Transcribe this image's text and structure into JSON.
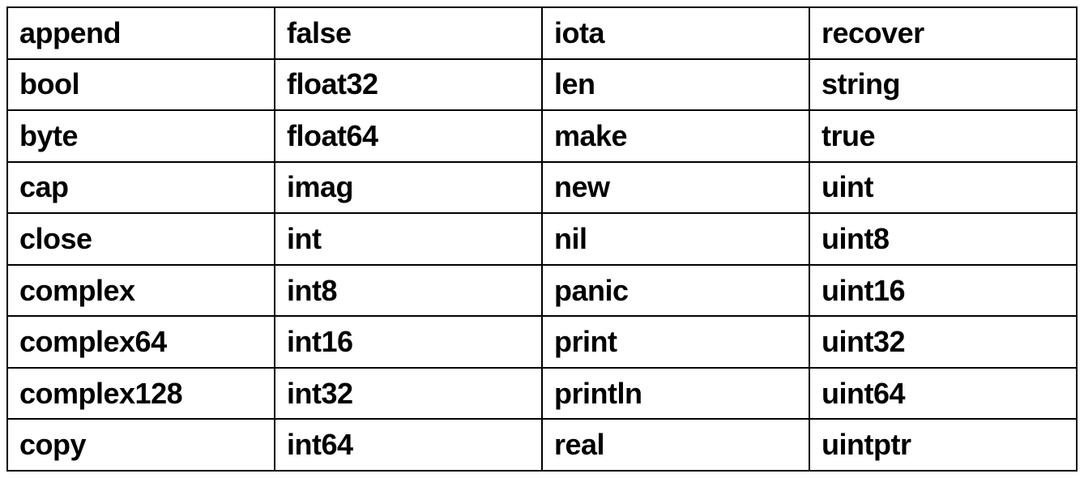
{
  "table": {
    "rows": [
      [
        "append",
        "false",
        "iota",
        "recover"
      ],
      [
        "bool",
        "float32",
        "len",
        "string"
      ],
      [
        "byte",
        "float64",
        "make",
        "true"
      ],
      [
        "cap",
        "imag",
        "new",
        "uint"
      ],
      [
        "close",
        "int",
        "nil",
        "uint8"
      ],
      [
        "complex",
        "int8",
        "panic",
        "uint16"
      ],
      [
        "complex64",
        "int16",
        "print",
        "uint32"
      ],
      [
        "complex128",
        "int32",
        "println",
        "uint64"
      ],
      [
        "copy",
        "int64",
        "real",
        "uintptr"
      ]
    ]
  }
}
